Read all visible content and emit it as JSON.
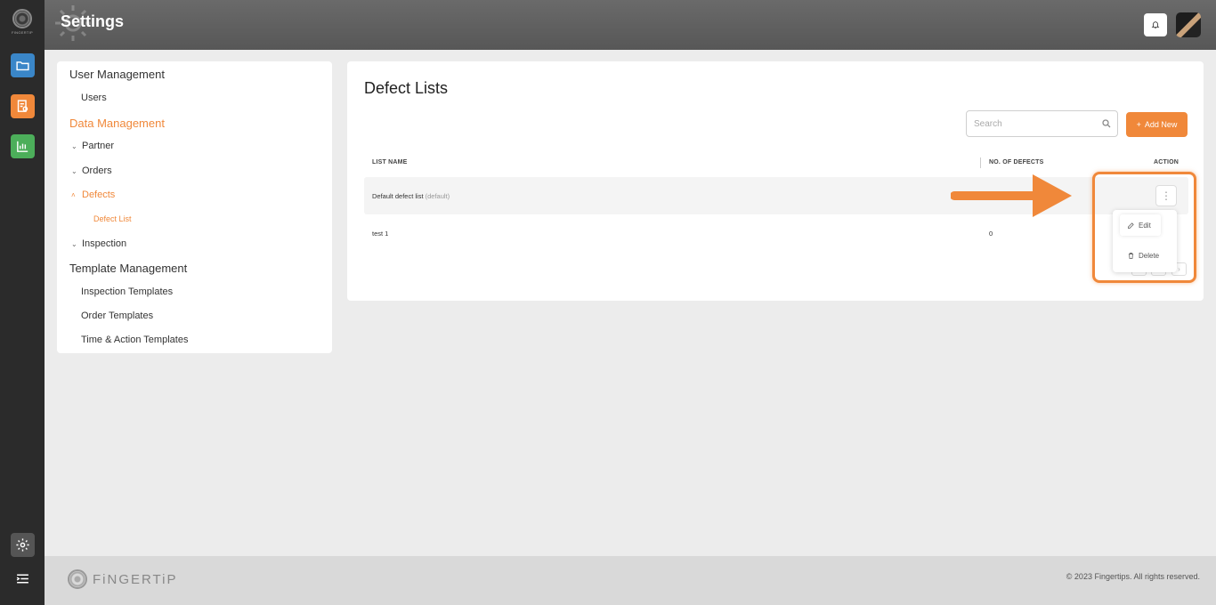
{
  "header": {
    "title": "Settings"
  },
  "rail": {
    "logo_text": "FINGERTIP"
  },
  "nav": {
    "user_management": "User Management",
    "users": "Users",
    "data_management": "Data Management",
    "partner": "Partner",
    "orders": "Orders",
    "defects": "Defects",
    "defect_list": "Defect List",
    "inspection": "Inspection",
    "template_management": "Template Management",
    "inspection_templates": "Inspection Templates",
    "order_templates": "Order Templates",
    "time_action_templates": "Time & Action Templates"
  },
  "main": {
    "title": "Defect Lists",
    "search_placeholder": "Search",
    "add_new": "Add New",
    "columns": {
      "list_name": "LIST NAME",
      "num_defects": "NO. OF DEFECTS",
      "action": "ACTION"
    },
    "rows": [
      {
        "name": "Default defect list",
        "tag": "(default)",
        "count": ""
      },
      {
        "name": "test 1",
        "tag": "",
        "count": "0"
      }
    ]
  },
  "menu": {
    "edit": "Edit",
    "delete": "Delete"
  },
  "footer": {
    "logo": "FiNGERTiP",
    "copyright": "© 2023 Fingertips. All rights reserved."
  },
  "colors": {
    "accent": "#f0883a",
    "rail": "#2b2b2b",
    "header": "#5f5f5f"
  },
  "icons": [
    "folder-icon",
    "report-icon",
    "chart-icon",
    "gear-icon",
    "menu-icon",
    "bell-icon",
    "search-icon",
    "plus-icon",
    "pencil-icon",
    "trash-icon",
    "kebab-icon"
  ]
}
